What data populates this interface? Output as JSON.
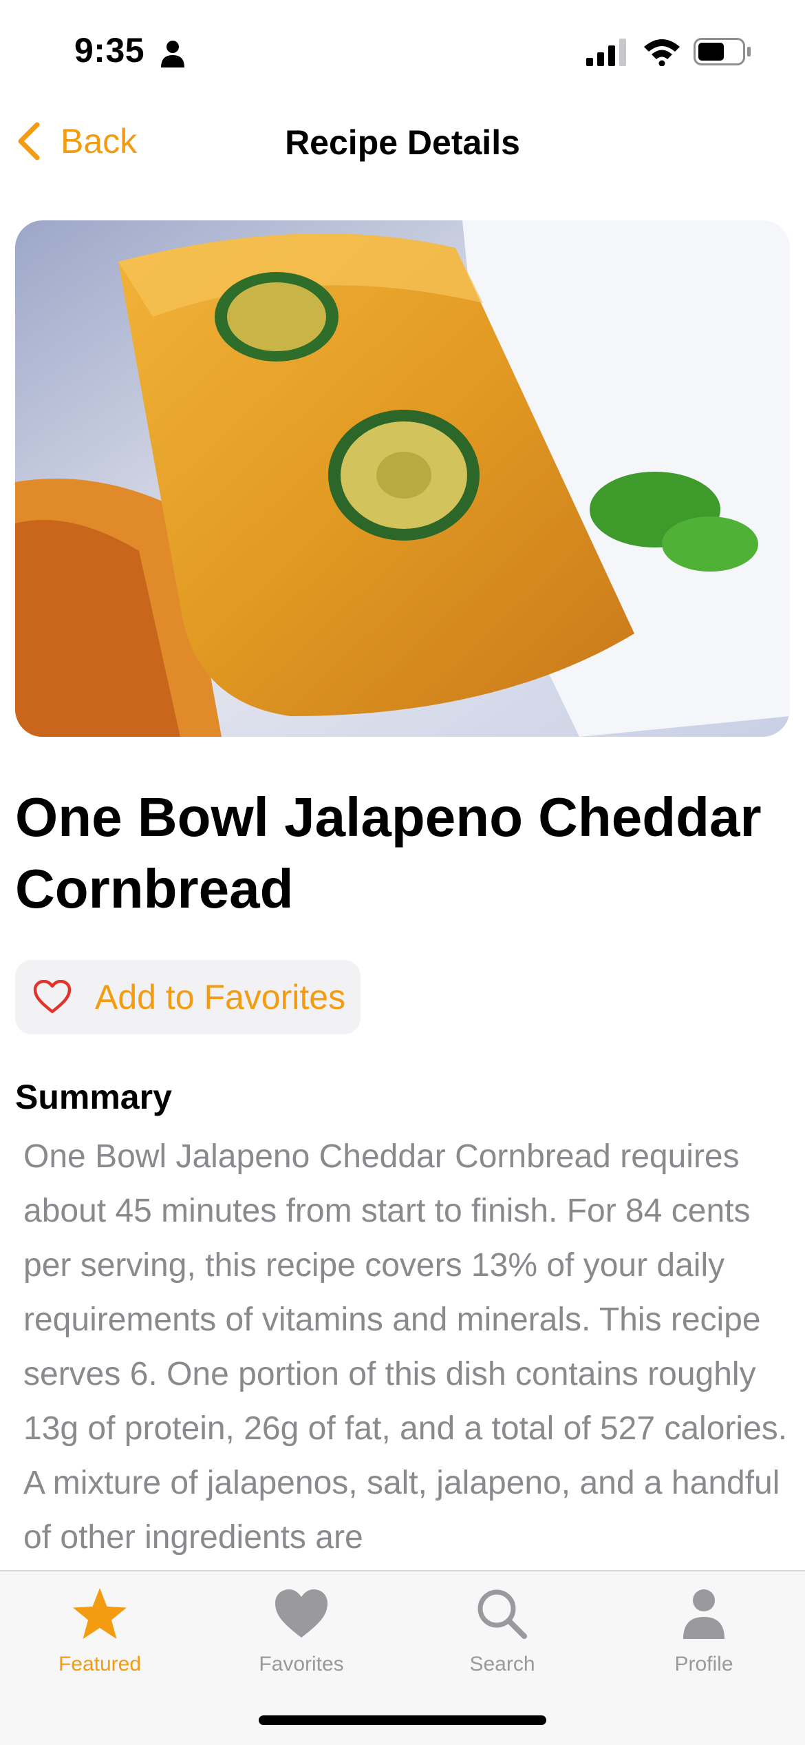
{
  "status_bar": {
    "time": "9:35",
    "battery_level": 0.6
  },
  "nav": {
    "back_label": "Back",
    "title": "Recipe Details"
  },
  "hero": {
    "image_name": "cornbread-photo"
  },
  "recipe": {
    "title": "One Bowl Jalapeno Cheddar Cornbread",
    "favorite_label": "Add to Favorites"
  },
  "summary": {
    "heading": "Summary",
    "text": "One Bowl Jalapeno Cheddar Cornbread requires about 45 minutes from start to finish. For 84 cents per serving, this recipe covers 13% of your daily requirements of vitamins and minerals. This recipe serves 6. One portion of this dish contains roughly 13g of protein, 26g of fat, and a total of 527 calories. A mixture of jalapenos, salt, jalapeno, and a handful of other ingredients are"
  },
  "tabs": [
    {
      "label": "Featured",
      "icon": "star-icon",
      "active": true
    },
    {
      "label": "Favorites",
      "icon": "heart-icon",
      "active": false
    },
    {
      "label": "Search",
      "icon": "magnifier-icon",
      "active": false
    },
    {
      "label": "Profile",
      "icon": "person-icon",
      "active": false
    }
  ],
  "colors": {
    "accent": "#F39C12",
    "muted": "#8A8A8E",
    "heart": "#E0352B",
    "tab_inactive": "#9A9A9E"
  }
}
